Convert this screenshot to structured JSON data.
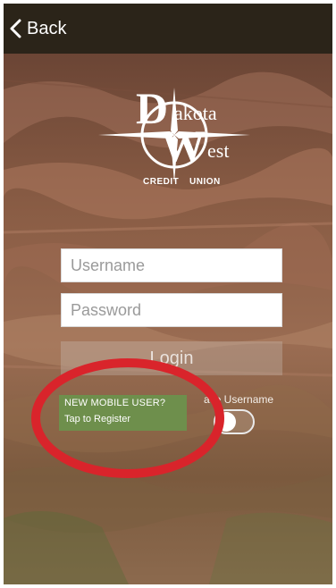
{
  "nav": {
    "back_label": "Back"
  },
  "logo": {
    "letter_d": "D",
    "word_dakota": "akota",
    "letter_w": "W",
    "word_west": "est",
    "tagline_left": "CREDIT",
    "tagline_right": "UNION"
  },
  "form": {
    "username_placeholder": "Username",
    "password_placeholder": "Password",
    "login_label": "Login",
    "save_username_label": "ave Username",
    "save_username_on": false
  },
  "register": {
    "line1": "NEW MOBILE USER?",
    "line2": "Tap to Register"
  },
  "colors": {
    "navbar": "#2b2419",
    "register_bg": "#6e8f4c",
    "annotation_circle": "#d9242b",
    "field_bg": "#ffffff"
  }
}
